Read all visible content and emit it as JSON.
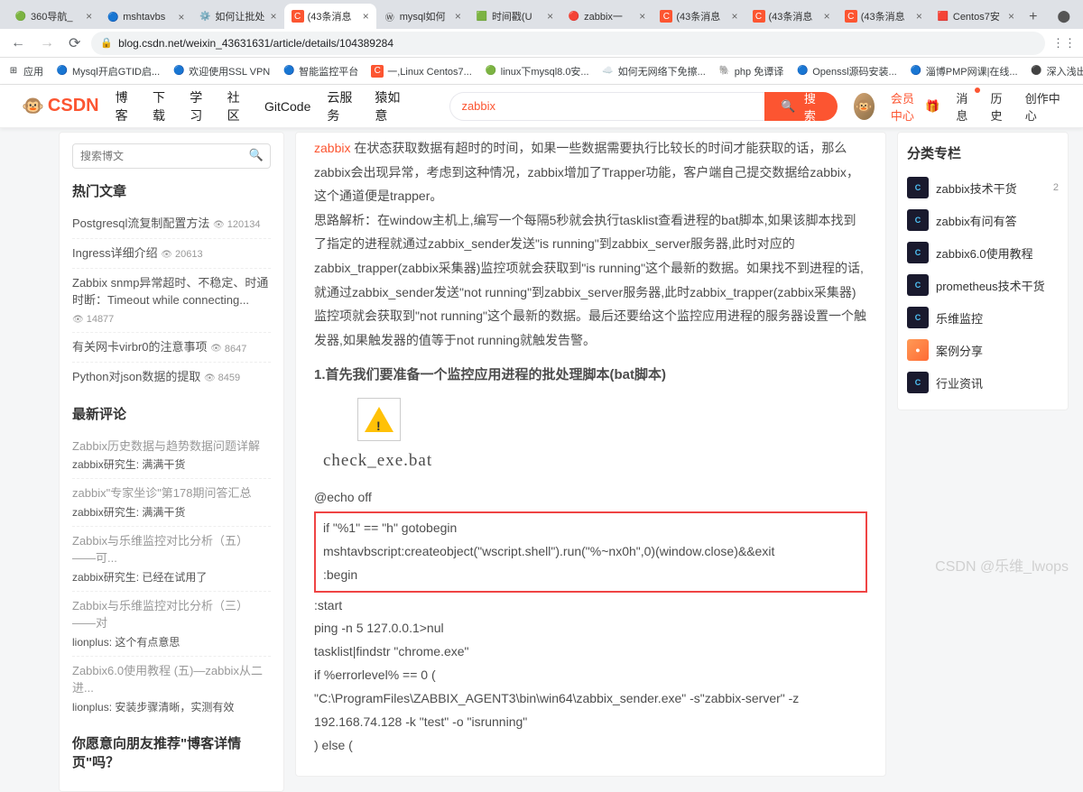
{
  "browser": {
    "tabs": [
      {
        "title": "360导航_",
        "favicon": "🟢"
      },
      {
        "title": "mshtavbs",
        "favicon": "🔵"
      },
      {
        "title": "如何让批处",
        "favicon": "⚙️"
      },
      {
        "title": "(43条消息",
        "favicon": "C",
        "active": true
      },
      {
        "title": "mysql如何",
        "favicon": "Ⓦ"
      },
      {
        "title": "时间戳(U",
        "favicon": "🟩"
      },
      {
        "title": "zabbix一",
        "favicon": "🔴"
      },
      {
        "title": "(43条消息",
        "favicon": "C"
      },
      {
        "title": "(43条消息",
        "favicon": "C"
      },
      {
        "title": "(43条消息",
        "favicon": "C"
      },
      {
        "title": "Centos7安",
        "favicon": "🟥"
      }
    ],
    "url": "blog.csdn.net/weixin_43631631/article/details/104389284"
  },
  "bookmarks": [
    {
      "icon": "⊞",
      "label": "应用"
    },
    {
      "icon": "🔵",
      "label": "Mysql开启GTID启..."
    },
    {
      "icon": "🔵",
      "label": "欢迎使用SSL VPN"
    },
    {
      "icon": "🔵",
      "label": "智能监控平台"
    },
    {
      "icon": "C",
      "label": "一,Linux Centos7..."
    },
    {
      "icon": "🟢",
      "label": "linux下mysql8.0安..."
    },
    {
      "icon": "☁️",
      "label": "如何无网络下免擦..."
    },
    {
      "icon": "🐘",
      "label": "php 免谭译"
    },
    {
      "icon": "🔵",
      "label": "Openssl源码安装..."
    },
    {
      "icon": "🔵",
      "label": "淄博PMP网课|在线..."
    },
    {
      "icon": "⚫",
      "label": "深入浅出Docker电..."
    }
  ],
  "header": {
    "logo": "CSDN",
    "nav": [
      "博客",
      "下载",
      "学习",
      "社区",
      "GitCode",
      "云服务",
      "猿如意"
    ],
    "search_value": "zabbix",
    "search_btn": "搜索",
    "vip": "会员中心",
    "msg": "消息",
    "history": "历史",
    "create": "创作中心"
  },
  "sidebar": {
    "search_ph": "搜索博文",
    "hot_title": "热门文章",
    "hot": [
      {
        "title": "Postgresql流复制配置方法",
        "views": "120134"
      },
      {
        "title": "Ingress详细介绍",
        "views": "20613"
      },
      {
        "title": "Zabbix snmp异常超时、不稳定、时通时断：Timeout while connecting...",
        "views": "14877"
      },
      {
        "title": "有关网卡virbr0的注意事项",
        "views": "8647"
      },
      {
        "title": "Python对json数据的提取",
        "views": "8459"
      }
    ],
    "comments_title": "最新评论",
    "comments": [
      {
        "title": "Zabbix历史数据与趋势数据问题详解",
        "sub": "zabbix研究生: 满满干货"
      },
      {
        "title": "zabbix\"专家坐诊\"第178期问答汇总",
        "sub": "zabbix研究生: 满满干货"
      },
      {
        "title": "Zabbix与乐维监控对比分析（五）——可...",
        "sub": "zabbix研究生: 已经在试用了"
      },
      {
        "title": "Zabbix与乐维监控对比分析（三）——对",
        "sub": "lionplus: 这个有点意思"
      },
      {
        "title": "Zabbix6.0使用教程 (五)—zabbix从二进...",
        "sub": "lionplus: 安装步骤清晰，实测有效"
      }
    ],
    "recommend_q": "你愿意向朋友推荐\"博客详情页\"吗？"
  },
  "article": {
    "p1_frag1": "在状态获取数据有超时的时间，如果一些数据需要执行比较长的时间才能获取的话，那么zabbix会出现异常，考虑到这种情况，zabbix增加了Trapper功能，客户端自己提交数据给zabbix，这个通道便是trapper。",
    "p2": "思路解析：在window主机上,编写一个每隔5秒就会执行tasklist查看进程的bat脚本,如果该脚本找到了指定的进程就通过zabbix_sender发送\"is running\"到zabbix_server服务器,此时对应的zabbix_trapper(zabbix采集器)监控项就会获取到\"is running\"这个最新的数据。如果找不到进程的话,就通过zabbix_sender发送\"not running\"到zabbix_server服务器,此时zabbix_trapper(zabbix采集器)监控项就会获取到\"not running\"这个最新的数据。最后还要给这个监控应用进程的服务器设置一个触发器,如果触发器的值等于not running就触发告警。",
    "h3": "1.首先我们要准备一个监控应用进程的批处理脚本(bat脚本)",
    "bat_name": "check_exe.bat",
    "code": {
      "l1": "@echo off",
      "box1": "if \"%1\" == \"h\" gotobegin",
      "box2": "mshtavbscript:createobject(\"wscript.shell\").run(\"%~nx0h\",0)(window.close)&&exit",
      "box3": ":begin",
      "l5": ":start",
      "l6": "ping -n 5 127.0.0.1>nul",
      "l7": "tasklist|findstr \"chrome.exe\"",
      "l8": "if %errorlevel% == 0 (",
      "l9": "        \"C:\\ProgramFiles\\ZABBIX_AGENT3\\bin\\win64\\zabbix_sender.exe\" -s\"zabbix-server\" -z 192.168.74.128 -k \"test\" -o \"isrunning\"",
      "l10": ") else ("
    }
  },
  "rightbar": {
    "title": "分类专栏",
    "items": [
      {
        "label": "zabbix技术干货",
        "count": "2"
      },
      {
        "label": "zabbix有问有答"
      },
      {
        "label": "zabbix6.0使用教程"
      },
      {
        "label": "prometheus技术干货"
      },
      {
        "label": "乐维监控"
      },
      {
        "label": "案例分享",
        "thumb": "orange"
      },
      {
        "label": "行业资讯"
      }
    ]
  },
  "watermark": "CSDN @乐维_lwops"
}
